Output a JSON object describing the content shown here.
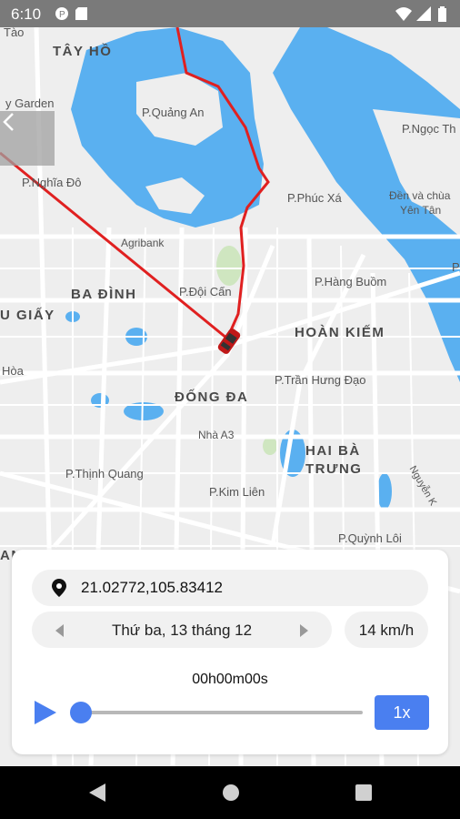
{
  "status_bar": {
    "time": "6:10",
    "left_icons": [
      "sync-icon",
      "sim-card-icon"
    ],
    "right_icons": [
      "wifi-icon",
      "signal-icon",
      "battery-icon"
    ]
  },
  "map": {
    "labels": [
      {
        "id": "tay-ho",
        "text": "TÂY HỒ"
      },
      {
        "id": "tao",
        "text": "Tào"
      },
      {
        "id": "y-garden",
        "text": "y Garden"
      },
      {
        "id": "p-quang-an",
        "text": "P.Quảng An"
      },
      {
        "id": "p-nghia-do",
        "text": "P.Nghĩa Đô"
      },
      {
        "id": "agribank",
        "text": "Agribank"
      },
      {
        "id": "p-phuc-xa",
        "text": "P.Phúc Xá"
      },
      {
        "id": "p-ngoc-thuy",
        "text": "P.Ngọc Th"
      },
      {
        "id": "den-va-chua",
        "text": "Đền và chùa"
      },
      {
        "id": "yen-tan",
        "text": "Yên Tân"
      },
      {
        "id": "ba-dinh",
        "text": "BA ĐÌNH"
      },
      {
        "id": "p-doi-can",
        "text": "P.Đội Cấn"
      },
      {
        "id": "p-hang-buom",
        "text": "P.Hàng Buồm"
      },
      {
        "id": "u-giay",
        "text": "U GIẤY"
      },
      {
        "id": "hoan-kiem",
        "text": "HOÀN KIẾM"
      },
      {
        "id": "hoa",
        "text": "Hòa"
      },
      {
        "id": "dong-da",
        "text": "ĐỐNG ĐA"
      },
      {
        "id": "p-tran-hung-dao",
        "text": "P.Trần Hưng Đạo"
      },
      {
        "id": "nha-a3",
        "text": "Nhà A3"
      },
      {
        "id": "hai-ba",
        "text": "HAI BÀ"
      },
      {
        "id": "trung",
        "text": "TRƯNG"
      },
      {
        "id": "p-thinh-quang",
        "text": "P.Thịnh Quang"
      },
      {
        "id": "p-kim-lien",
        "text": "P.Kim Liên"
      },
      {
        "id": "nguyen-k",
        "text": "Nguyễn K"
      },
      {
        "id": "p-quynh-loi",
        "text": "P.Quỳnh Lôi"
      },
      {
        "id": "p-edge",
        "text": "P"
      },
      {
        "id": "an",
        "text": "AN"
      }
    ]
  },
  "controls": {
    "back_icon": "chevron-left-icon",
    "coordinates": "21.02772,105.83412",
    "date": "Thứ ba, 13 tháng 12",
    "speed": "14 km/h",
    "elapsed": "00h00m00s",
    "playback_speed": "1x",
    "progress": 0,
    "accent_color": "#4a7ff0",
    "route_color": "#e02020",
    "water_color": "#5ab0f0"
  }
}
